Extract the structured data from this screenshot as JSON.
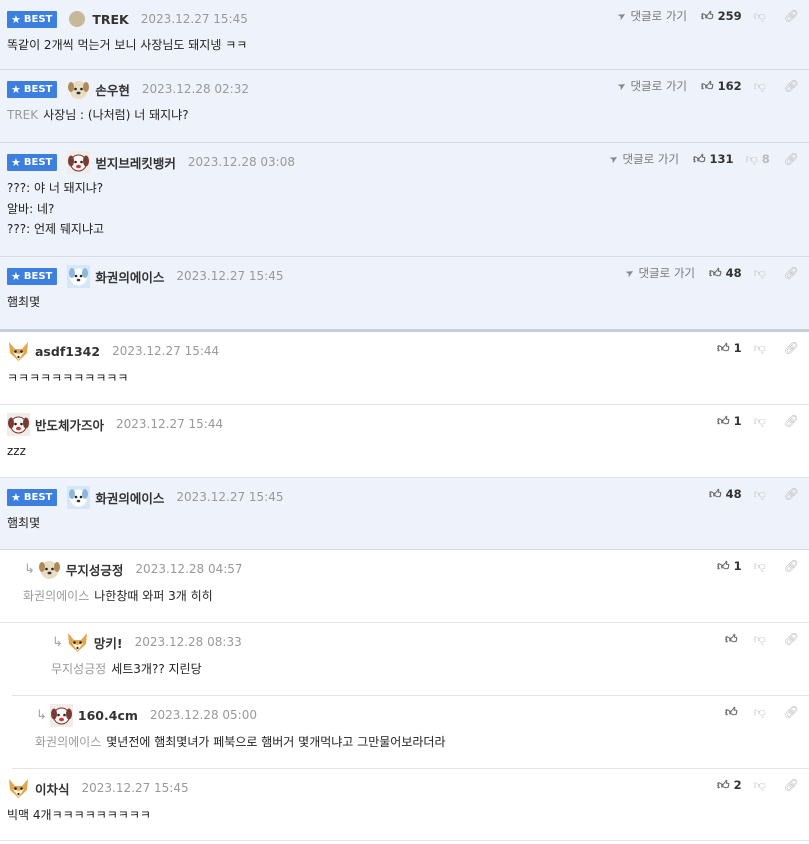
{
  "labels": {
    "best": "BEST",
    "reply_link": "댓글로 가기"
  },
  "comments": [
    {
      "best": true,
      "avatar": "tan-dot",
      "nick": "TREK",
      "date": "2023.12.27 15:45",
      "lines": [
        "똑같이 2개씩 먹는거 보니 사장님도 돼지넹 ㅋㅋ"
      ],
      "mention": "",
      "likes": "259",
      "dislikes": "",
      "has_reply_link": true
    },
    {
      "best": true,
      "avatar": "puppy",
      "nick": "손우현",
      "date": "2023.12.28 02:32",
      "lines": [
        "사장님 : (나처럼) 너 돼지냐?"
      ],
      "mention": "TREK",
      "likes": "162",
      "dislikes": "",
      "has_reply_link": true
    },
    {
      "best": true,
      "avatar": "dog-red",
      "nick": "벋지브레킷뱅커",
      "date": "2023.12.28 03:08",
      "lines": [
        "???: 야 너 돼지냐?",
        "알바: 네?",
        "???: 언제 뒈지냐고"
      ],
      "mention": "",
      "likes": "131",
      "dislikes": "8",
      "has_reply_link": true
    },
    {
      "best": true,
      "avatar": "blue-dog",
      "nick": "화권의에이스",
      "date": "2023.12.27 15:45",
      "lines": [
        "햄최몇"
      ],
      "mention": "",
      "likes": "48",
      "dislikes": "",
      "has_reply_link": true
    },
    {
      "best": false,
      "avatar": "fox",
      "nick": "asdf1342",
      "date": "2023.12.27 15:44",
      "lines": [
        "ㅋㅋㅋㅋㅋㅋㅋㅋㅋㅋㅋ"
      ],
      "mention": "",
      "likes": "1",
      "dislikes": "",
      "has_reply_link": false
    },
    {
      "best": false,
      "avatar": "dog-red",
      "nick": "반도체가즈아",
      "date": "2023.12.27 15:44",
      "lines": [
        "zzz"
      ],
      "mention": "",
      "likes": "1",
      "dislikes": "",
      "has_reply_link": false
    },
    {
      "best": true,
      "avatar": "blue-dog",
      "nick": "화권의에이스",
      "date": "2023.12.27 15:45",
      "lines": [
        "햄최몇"
      ],
      "mention": "",
      "likes": "48",
      "dislikes": "",
      "has_reply_link": false
    },
    {
      "best": false,
      "reply": true,
      "avatar": "puppy",
      "nick": "무지성긍정",
      "date": "2023.12.28 04:57",
      "lines": [
        "나한창때 와퍼 3개 히히"
      ],
      "mention": "화권의에이스",
      "likes": "1",
      "dislikes": "",
      "has_reply_link": false
    },
    {
      "best": false,
      "reply": true,
      "avatar": "fox",
      "nick": "망키!",
      "date": "2023.12.28 08:33",
      "lines": [
        "세트3개?? 지린당"
      ],
      "mention": "무지성긍정",
      "likes": "",
      "dislikes": "",
      "has_reply_link": false
    },
    {
      "best": false,
      "reply": true,
      "avatar": "dog-red",
      "nick": "160.4cm",
      "date": "2023.12.28 05:00",
      "lines": [
        "몇년전에 햄최몇녀가 페북으로 햄버거 몇개먹냐고 그만물어보라더라"
      ],
      "mention": "화권의에이스",
      "likes": "",
      "dislikes": "",
      "has_reply_link": false
    },
    {
      "best": false,
      "avatar": "fox",
      "nick": "이차식",
      "date": "2023.12.27 15:45",
      "lines": [
        "빅맥 4개ㅋㅋㅋㅋㅋㅋㅋㅋㅋ"
      ],
      "mention": "",
      "likes": "2",
      "dislikes": "",
      "has_reply_link": false
    }
  ]
}
